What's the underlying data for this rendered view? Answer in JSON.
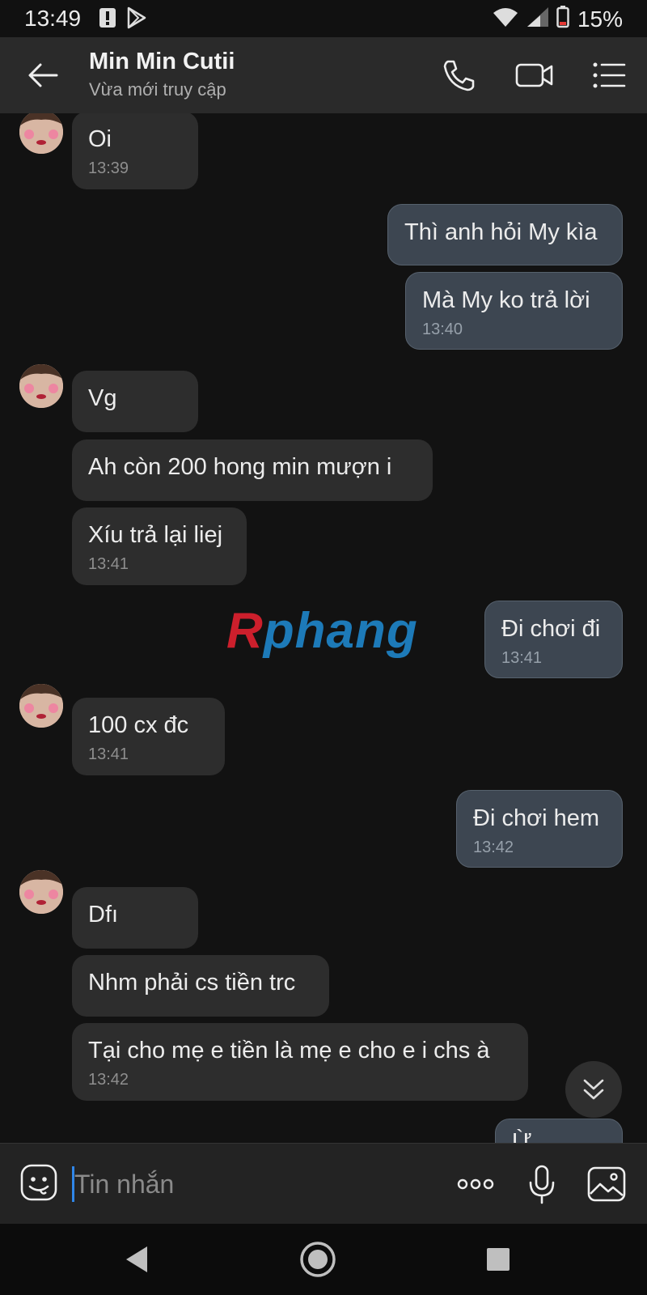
{
  "status_bar": {
    "time": "13:49",
    "battery_percent": "15%",
    "icons": [
      "alert-icon",
      "play-store-icon",
      "wifi-icon",
      "signal-icon",
      "battery-icon"
    ]
  },
  "header": {
    "contact_name": "Min Min Cutii",
    "contact_status": "Vừa mới truy cập",
    "actions": [
      "back-arrow-icon",
      "phone-icon",
      "video-call-icon",
      "menu-icon"
    ]
  },
  "messages": [
    {
      "from": "contact",
      "text": "Oi",
      "time": "13:39"
    },
    {
      "from": "me",
      "text": "Thì anh hỏi My kìa",
      "time": ""
    },
    {
      "from": "me",
      "text": "Mà My ko trả lời",
      "time": "13:40"
    },
    {
      "from": "contact",
      "text": "Vg",
      "time": ""
    },
    {
      "from": "contact",
      "text": "Ah còn 200 hong min mượn i",
      "time": ""
    },
    {
      "from": "contact",
      "text": "Xíu trả lại liej",
      "time": "13:41"
    },
    {
      "from": "me",
      "text": "Đi chơi đi",
      "time": "13:41"
    },
    {
      "from": "contact",
      "text": "100  cx đc",
      "time": "13:41"
    },
    {
      "from": "me",
      "text": "Đi chơi hem",
      "time": "13:42"
    },
    {
      "from": "contact",
      "text": "Dfı",
      "time": ""
    },
    {
      "from": "contact",
      "text": "Nhm phải cs tiền trc",
      "time": ""
    },
    {
      "from": "contact",
      "text": "Tại cho mẹ e tiền là mẹ e cho e i chs à",
      "time": "13:42"
    },
    {
      "from": "me",
      "text": "Ừ",
      "time": ""
    }
  ],
  "watermark": {
    "first_letter": "R",
    "rest": "phang"
  },
  "input": {
    "placeholder": "Tin nhắn",
    "value": ""
  },
  "colors": {
    "background": "#121212",
    "header": "#2a2a2a",
    "incoming_bubble": "#2d2d2d",
    "outgoing_bubble": "#3d4651",
    "caret": "#2f86e8"
  }
}
